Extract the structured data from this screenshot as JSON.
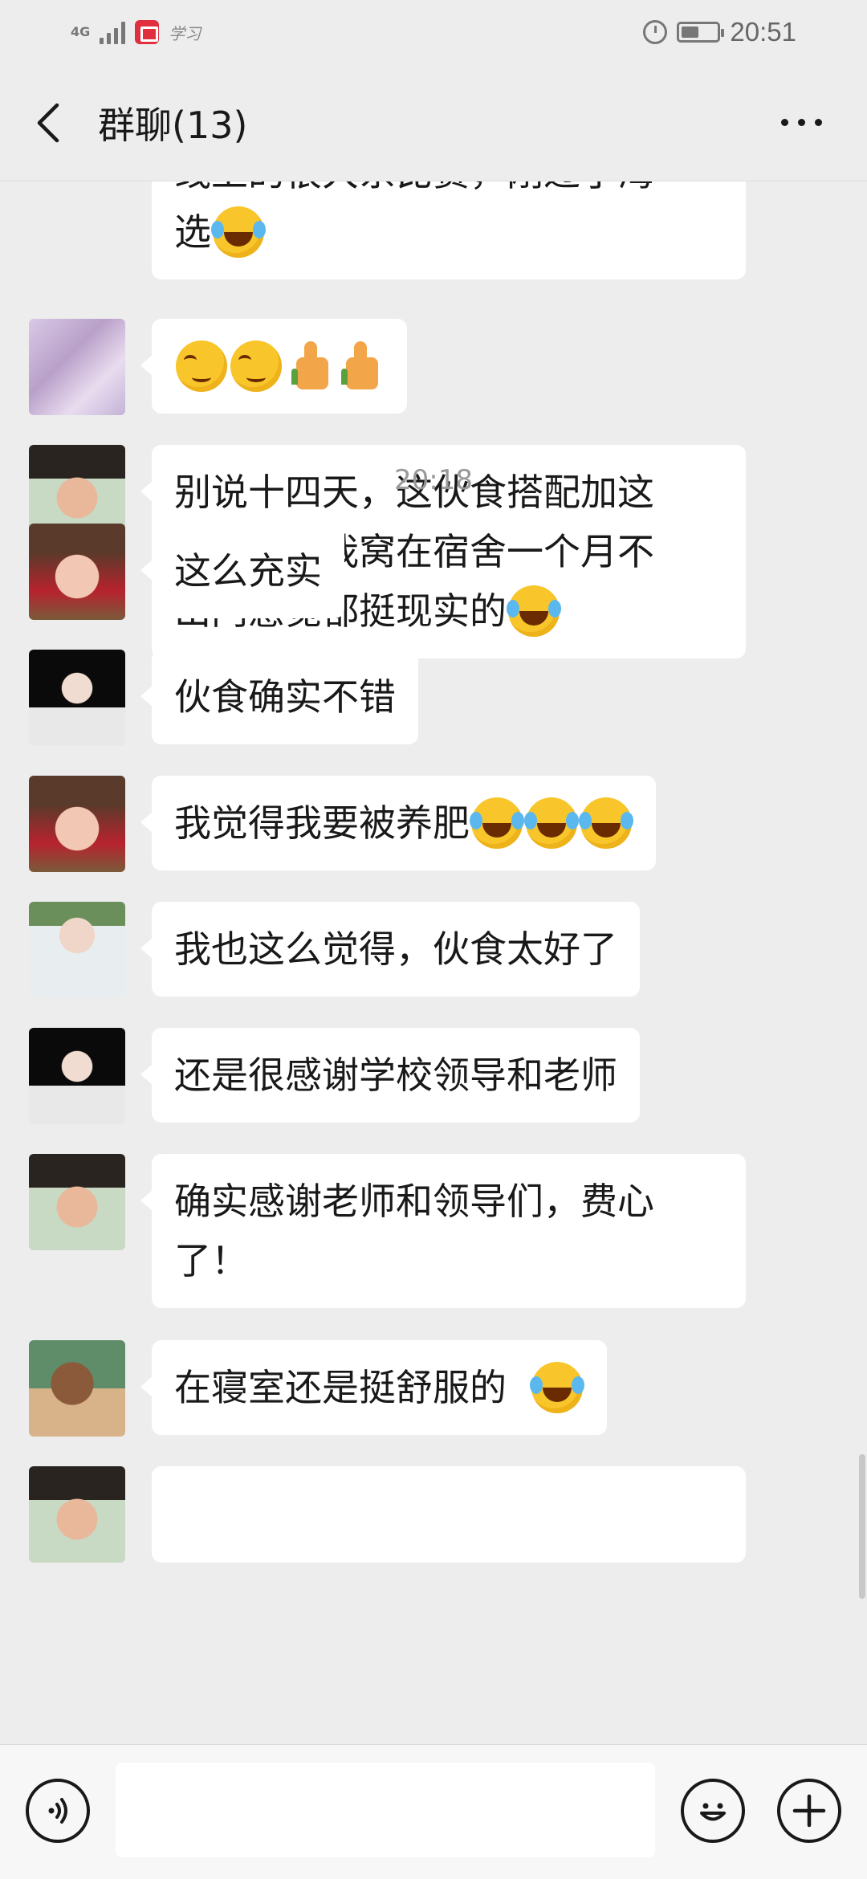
{
  "status_bar": {
    "network": "4G",
    "app_label": "学习",
    "time": "20:51",
    "icons": [
      "signal-icon",
      "app-notification-icon",
      "alarm-icon",
      "battery-icon"
    ]
  },
  "header": {
    "title": "群聊(13)",
    "back_icon": "chevron-left-icon",
    "more_icon": "more-dots-icon"
  },
  "messages": [
    {
      "id": "m0",
      "text_line1": "线上的很大系比赛，刚过了海",
      "text_line2": "选",
      "trailing_emoji": [
        "laugh-cry"
      ]
    },
    {
      "id": "m1",
      "avatar": "avatar-1",
      "text": "",
      "emojis": [
        "smirk",
        "smirk",
        "thumbs-up",
        "thumbs-up"
      ]
    },
    {
      "id": "m2",
      "avatar": "avatar-2",
      "lines": [
        "别说十四天，这伙食搭配加这",
        "待遇，让我窝在宿舍一个月不",
        "出门感觉都挺现实的"
      ],
      "trailing_emoji": [
        "laugh-cry"
      ]
    },
    {
      "id": "ts",
      "timestamp": "20:18"
    },
    {
      "id": "m3",
      "avatar": "avatar-3",
      "text": "这么充实"
    },
    {
      "id": "m4",
      "avatar": "avatar-4",
      "text": "伙食确实不错"
    },
    {
      "id": "m5",
      "avatar": "avatar-3",
      "text": "我觉得我要被养肥",
      "trailing_emoji": [
        "laugh-cry",
        "laugh-cry",
        "laugh-cry"
      ]
    },
    {
      "id": "m6",
      "avatar": "avatar-5",
      "text": "我也这么觉得，伙食太好了"
    },
    {
      "id": "m7",
      "avatar": "avatar-4",
      "text": "还是很感谢学校领导和老师"
    },
    {
      "id": "m8",
      "avatar": "avatar-2",
      "lines": [
        "确实感谢老师和领导们，费心",
        "了！"
      ]
    },
    {
      "id": "m9",
      "avatar": "avatar-6",
      "text": "在寝室还是挺舒服的",
      "trailing_emoji": [
        "laugh-cry"
      ]
    }
  ],
  "input_bar": {
    "voice_icon": "voice-icon",
    "emoji_icon": "emoji-icon",
    "plus_icon": "plus-icon",
    "input_value": ""
  },
  "colors": {
    "background": "#ededed",
    "bubble": "#ffffff",
    "text": "#191919",
    "timestamp": "#999999"
  }
}
